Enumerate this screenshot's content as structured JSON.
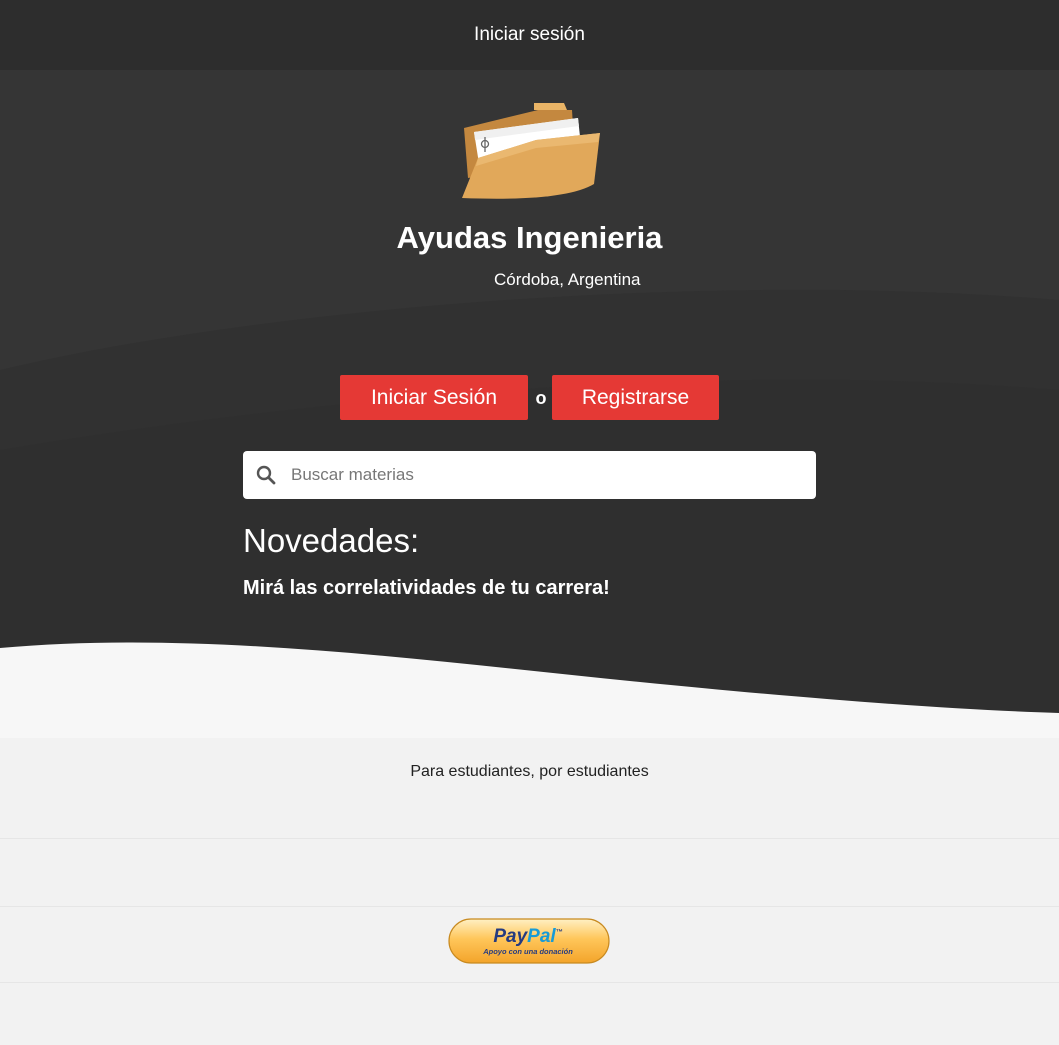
{
  "header": {
    "login_link": "Iniciar sesión"
  },
  "hero": {
    "title": "Ayudas Ingenieria",
    "subtitle": "Córdoba, Argentina",
    "login_button": "Iniciar Sesión",
    "or_text": "o",
    "register_button": "Registrarse",
    "search": {
      "placeholder": "Buscar materias",
      "value": ""
    },
    "news_title": "Novedades:",
    "news_item": "Mirá las correlatividades de tu carrera!"
  },
  "footer": {
    "tagline": "Para estudiantes, por estudiantes",
    "donate": {
      "brand_first": "Pay",
      "brand_second": "Pal",
      "trademark": "™",
      "caption": "Apoyo con una donación"
    }
  },
  "colors": {
    "header_bg": "#2d2d2d",
    "hero_bg": "#353535",
    "accent": "#e53935",
    "footer_bg": "#f2f2f2",
    "folder": "#e1a85a"
  },
  "icons": {
    "logo": "folder-icon",
    "search": "search-icon"
  }
}
